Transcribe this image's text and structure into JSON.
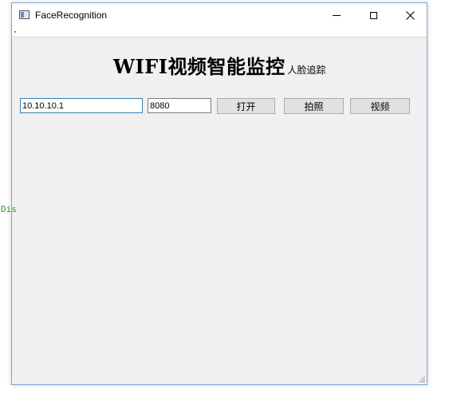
{
  "window": {
    "title": "FaceRecognition"
  },
  "heading": {
    "main": "WIFI视频智能监控",
    "sub": "人脸追踪"
  },
  "connection": {
    "ip_value": "10.10.10.1",
    "port_value": "8080"
  },
  "buttons": {
    "open_label": "打开",
    "photo_label": "拍照",
    "video_label": "视频"
  },
  "stray": {
    "text": "Dis"
  },
  "colors": {
    "window_border": "#7aa7d8",
    "client_bg": "#f0f0f0",
    "focus_border": "#3c7fb1",
    "stray_text": "#2a9a2a"
  },
  "icons": {
    "app": "app-window-icon",
    "minimize": "minimize-icon",
    "maximize": "maximize-icon",
    "close": "close-icon"
  }
}
